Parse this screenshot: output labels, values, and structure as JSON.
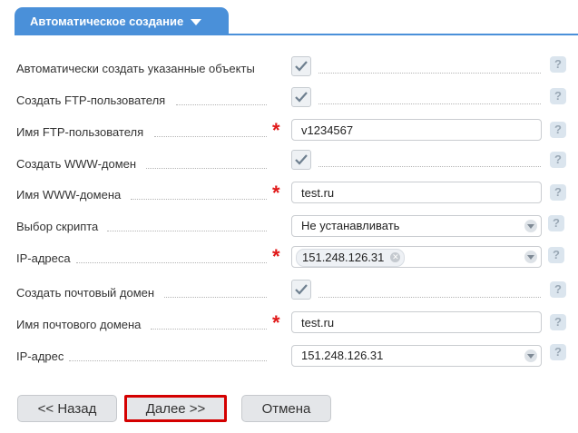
{
  "tab": {
    "label": "Автоматическое создание"
  },
  "form": {
    "rows": [
      {
        "label": "Автоматически создать указанные объекты"
      },
      {
        "label": "Создать FTP-пользователя"
      },
      {
        "label": "Имя FTP-пользователя",
        "value": "v1234567"
      },
      {
        "label": "Создать WWW-домен"
      },
      {
        "label": "Имя WWW-домена",
        "value": "test.ru"
      },
      {
        "label": "Выбор скрипта",
        "value": "Не устанавливать"
      },
      {
        "label": "IP-адреса",
        "chip": "151.248.126.31"
      },
      {
        "label": "Создать почтовый домен"
      },
      {
        "label": "Имя почтового домена",
        "value": "test.ru"
      },
      {
        "label": "IP-адрес",
        "value": "151.248.126.31"
      }
    ],
    "required_mark": "*",
    "help_mark": "?"
  },
  "buttons": {
    "back": "<< Назад",
    "next": "Далее >>",
    "cancel": "Отмена"
  }
}
